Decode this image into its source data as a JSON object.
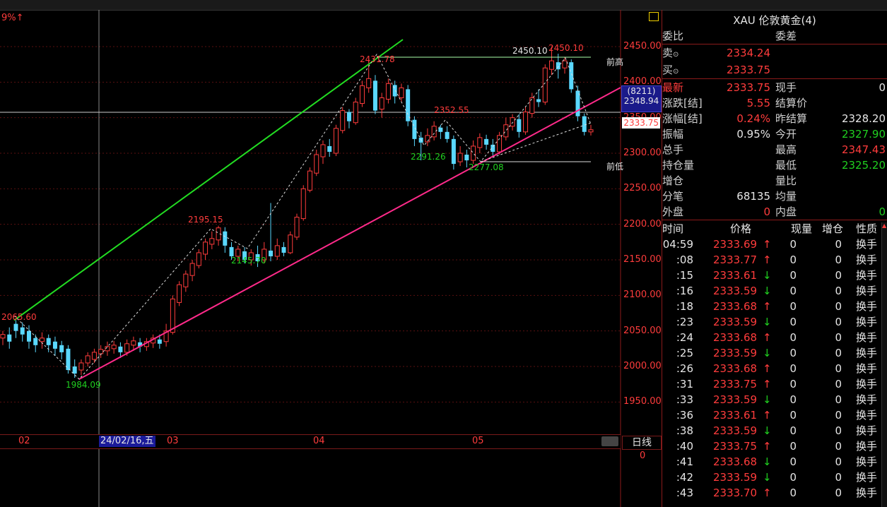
{
  "toolbar": {
    "left_text": "9%↑"
  },
  "instrument": {
    "title": "XAU 伦敦黄金(4)"
  },
  "colors": {
    "up": "#ff3c3c",
    "down": "#5ad8ff",
    "support_line": "#ff2a8a",
    "channel_line": "#22dd22",
    "grid": "#5a1010"
  },
  "y_axis": {
    "ticks": [
      "2450.00",
      "2400.00",
      "2350.00",
      "2300.00",
      "2250.00",
      "2200.00",
      "2150.00",
      "2100.00",
      "2050.00",
      "2000.00",
      "1950.00"
    ],
    "current_tag": "2333.75",
    "highlight_count": "(8211)",
    "highlight_price": "2348.94"
  },
  "x_axis": {
    "labels": [
      "02",
      "03",
      "04",
      "05"
    ],
    "cursor_date": "24/02/16,五",
    "period_button": "日线",
    "sub_value": "0"
  },
  "annotations": {
    "high_1": "2450.10",
    "high_2": "2450.10",
    "peak_left": "2431.78",
    "mid_1": "2352.55",
    "low_1": "2291.26",
    "low_2": "2277.08",
    "high_3": "2195.15",
    "low_3": "2145.70",
    "start_high": "2065.60",
    "start_low": "1984.09",
    "prev_high": "前高",
    "prev_low": "前低"
  },
  "chart_data": {
    "type": "candlestick",
    "ylim": [
      1920,
      2480
    ],
    "candles": [
      [
        2040,
        2045,
        2030,
        2050
      ],
      [
        2045,
        2035,
        2025,
        2055
      ],
      [
        2060,
        2050,
        2040,
        2065
      ],
      [
        2055,
        2045,
        2035,
        2062
      ],
      [
        2050,
        2035,
        2025,
        2058
      ],
      [
        2040,
        2030,
        2020,
        2045
      ],
      [
        2035,
        2040,
        2025,
        2048
      ],
      [
        2040,
        2030,
        2020,
        2045
      ],
      [
        2035,
        2025,
        2015,
        2042
      ],
      [
        2030,
        2020,
        2010,
        2036
      ],
      [
        2025,
        1995,
        1990,
        2030
      ],
      [
        2000,
        1990,
        1984,
        2010
      ],
      [
        1995,
        2005,
        1988,
        2010
      ],
      [
        2005,
        2015,
        2000,
        2020
      ],
      [
        2010,
        2020,
        2005,
        2025
      ],
      [
        2018,
        2024,
        2012,
        2030
      ],
      [
        2022,
        2028,
        2015,
        2035
      ],
      [
        2025,
        2030,
        2018,
        2036
      ],
      [
        2028,
        2020,
        2012,
        2034
      ],
      [
        2020,
        2032,
        2015,
        2038
      ],
      [
        2030,
        2036,
        2022,
        2042
      ],
      [
        2034,
        2028,
        2020,
        2040
      ],
      [
        2028,
        2035,
        2022,
        2040
      ],
      [
        2033,
        2040,
        2026,
        2045
      ],
      [
        2038,
        2032,
        2025,
        2045
      ],
      [
        2035,
        2050,
        2028,
        2060
      ],
      [
        2048,
        2095,
        2045,
        2100
      ],
      [
        2090,
        2115,
        2085,
        2120
      ],
      [
        2112,
        2130,
        2105,
        2135
      ],
      [
        2128,
        2145,
        2120,
        2150
      ],
      [
        2142,
        2160,
        2138,
        2165
      ],
      [
        2158,
        2175,
        2150,
        2180
      ],
      [
        2172,
        2180,
        2165,
        2190
      ],
      [
        2178,
        2195,
        2170,
        2198
      ],
      [
        2190,
        2170,
        2160,
        2196
      ],
      [
        2168,
        2155,
        2150,
        2175
      ],
      [
        2155,
        2165,
        2148,
        2170
      ],
      [
        2162,
        2150,
        2145,
        2168
      ],
      [
        2150,
        2160,
        2142,
        2165
      ],
      [
        2158,
        2148,
        2140,
        2170
      ],
      [
        2150,
        2165,
        2145,
        2175
      ],
      [
        2163,
        2155,
        2148,
        2230
      ],
      [
        2155,
        2170,
        2150,
        2180
      ],
      [
        2168,
        2160,
        2155,
        2175
      ],
      [
        2160,
        2185,
        2158,
        2190
      ],
      [
        2182,
        2210,
        2178,
        2215
      ],
      [
        2208,
        2250,
        2205,
        2255
      ],
      [
        2248,
        2275,
        2245,
        2280
      ],
      [
        2272,
        2298,
        2268,
        2305
      ],
      [
        2295,
        2312,
        2285,
        2318
      ],
      [
        2310,
        2302,
        2295,
        2320
      ],
      [
        2300,
        2335,
        2296,
        2340
      ],
      [
        2332,
        2360,
        2328,
        2365
      ],
      [
        2358,
        2345,
        2335,
        2362
      ],
      [
        2343,
        2372,
        2340,
        2378
      ],
      [
        2370,
        2395,
        2365,
        2402
      ],
      [
        2392,
        2405,
        2385,
        2431
      ],
      [
        2402,
        2360,
        2355,
        2410
      ],
      [
        2362,
        2378,
        2350,
        2385
      ],
      [
        2376,
        2398,
        2370,
        2405
      ],
      [
        2396,
        2380,
        2370,
        2402
      ],
      [
        2378,
        2392,
        2372,
        2398
      ],
      [
        2390,
        2345,
        2338,
        2396
      ],
      [
        2347,
        2320,
        2310,
        2352
      ],
      [
        2322,
        2315,
        2290,
        2330
      ],
      [
        2316,
        2325,
        2310,
        2335
      ],
      [
        2323,
        2338,
        2318,
        2345
      ],
      [
        2336,
        2330,
        2320,
        2340
      ],
      [
        2330,
        2320,
        2315,
        2338
      ],
      [
        2320,
        2285,
        2277,
        2325
      ],
      [
        2288,
        2300,
        2282,
        2310
      ],
      [
        2298,
        2290,
        2280,
        2305
      ],
      [
        2290,
        2310,
        2285,
        2318
      ],
      [
        2308,
        2322,
        2300,
        2328
      ],
      [
        2320,
        2312,
        2305,
        2326
      ],
      [
        2312,
        2302,
        2295,
        2320
      ],
      [
        2302,
        2325,
        2298,
        2330
      ],
      [
        2323,
        2340,
        2318,
        2350
      ],
      [
        2338,
        2350,
        2332,
        2355
      ],
      [
        2348,
        2330,
        2322,
        2355
      ],
      [
        2330,
        2358,
        2326,
        2365
      ],
      [
        2356,
        2378,
        2350,
        2385
      ],
      [
        2376,
        2372,
        2365,
        2390
      ],
      [
        2372,
        2420,
        2368,
        2425
      ],
      [
        2418,
        2430,
        2410,
        2450
      ],
      [
        2428,
        2418,
        2405,
        2440
      ],
      [
        2420,
        2430,
        2412,
        2435
      ],
      [
        2428,
        2390,
        2385,
        2432
      ],
      [
        2388,
        2352,
        2345,
        2395
      ],
      [
        2352,
        2330,
        2325,
        2356
      ],
      [
        2330,
        2333,
        2325,
        2340
      ]
    ]
  },
  "quote": {
    "row1": {
      "l1": "委比",
      "v1": "",
      "l2": "委差",
      "v2": ""
    },
    "sell": {
      "label": "卖",
      "value": "2334.24"
    },
    "buy": {
      "label": "买",
      "value": "2333.75"
    },
    "rows": [
      {
        "l1": "最新",
        "v1": "2333.75",
        "c1": "red",
        "l2": "现手",
        "v2": "0",
        "c2": "white"
      },
      {
        "l1": "涨跌[结]",
        "v1": "5.55",
        "c1": "red",
        "l2": "结算价",
        "v2": "",
        "c2": "white"
      },
      {
        "l1": "涨幅[结]",
        "v1": "0.24%",
        "c1": "red",
        "l2": "昨结算",
        "v2": "2328.20",
        "c2": "white"
      },
      {
        "l1": "振幅",
        "v1": "0.95%",
        "c1": "white",
        "l2": "今开",
        "v2": "2327.90",
        "c2": "green"
      },
      {
        "l1": "总手",
        "v1": "",
        "c1": "white",
        "l2": "最高",
        "v2": "2347.43",
        "c2": "red"
      },
      {
        "l1": "持仓量",
        "v1": "",
        "c1": "white",
        "l2": "最低",
        "v2": "2325.20",
        "c2": "green"
      },
      {
        "l1": "增仓",
        "v1": "",
        "c1": "white",
        "l2": "量比",
        "v2": "",
        "c2": "white"
      },
      {
        "l1": "分笔",
        "v1": "68135",
        "c1": "white",
        "l2": "均量",
        "v2": "",
        "c2": "white"
      },
      {
        "l1": "外盘",
        "v1": "0",
        "c1": "red",
        "l2": "内盘",
        "v2": "0",
        "c2": "green"
      }
    ]
  },
  "ticks_table": {
    "headers": [
      "时间",
      "价格",
      "现量",
      "增仓",
      "性质"
    ],
    "rows": [
      {
        "t": "04:59",
        "p": "2333.69",
        "d": "↑",
        "q": "0",
        "z": "0",
        "x": "换手"
      },
      {
        "t": ":08",
        "p": "2333.77",
        "d": "↑",
        "q": "0",
        "z": "0",
        "x": "换手"
      },
      {
        "t": ":15",
        "p": "2333.61",
        "d": "↓",
        "q": "0",
        "z": "0",
        "x": "换手"
      },
      {
        "t": ":16",
        "p": "2333.59",
        "d": "↓",
        "q": "0",
        "z": "0",
        "x": "换手"
      },
      {
        "t": ":18",
        "p": "2333.68",
        "d": "↑",
        "q": "0",
        "z": "0",
        "x": "换手"
      },
      {
        "t": ":23",
        "p": "2333.59",
        "d": "↓",
        "q": "0",
        "z": "0",
        "x": "换手"
      },
      {
        "t": ":24",
        "p": "2333.68",
        "d": "↑",
        "q": "0",
        "z": "0",
        "x": "换手"
      },
      {
        "t": ":25",
        "p": "2333.59",
        "d": "↓",
        "q": "0",
        "z": "0",
        "x": "换手"
      },
      {
        "t": ":26",
        "p": "2333.68",
        "d": "↑",
        "q": "0",
        "z": "0",
        "x": "换手"
      },
      {
        "t": ":31",
        "p": "2333.75",
        "d": "↑",
        "q": "0",
        "z": "0",
        "x": "换手"
      },
      {
        "t": ":33",
        "p": "2333.59",
        "d": "↓",
        "q": "0",
        "z": "0",
        "x": "换手"
      },
      {
        "t": ":36",
        "p": "2333.61",
        "d": "↑",
        "q": "0",
        "z": "0",
        "x": "换手"
      },
      {
        "t": ":38",
        "p": "2333.59",
        "d": "↓",
        "q": "0",
        "z": "0",
        "x": "换手"
      },
      {
        "t": ":40",
        "p": "2333.75",
        "d": "↑",
        "q": "0",
        "z": "0",
        "x": "换手"
      },
      {
        "t": ":41",
        "p": "2333.68",
        "d": "↓",
        "q": "0",
        "z": "0",
        "x": "换手"
      },
      {
        "t": ":42",
        "p": "2333.59",
        "d": "↓",
        "q": "0",
        "z": "0",
        "x": "换手"
      },
      {
        "t": ":43",
        "p": "2333.70",
        "d": "↑",
        "q": "0",
        "z": "0",
        "x": "换手"
      }
    ]
  }
}
